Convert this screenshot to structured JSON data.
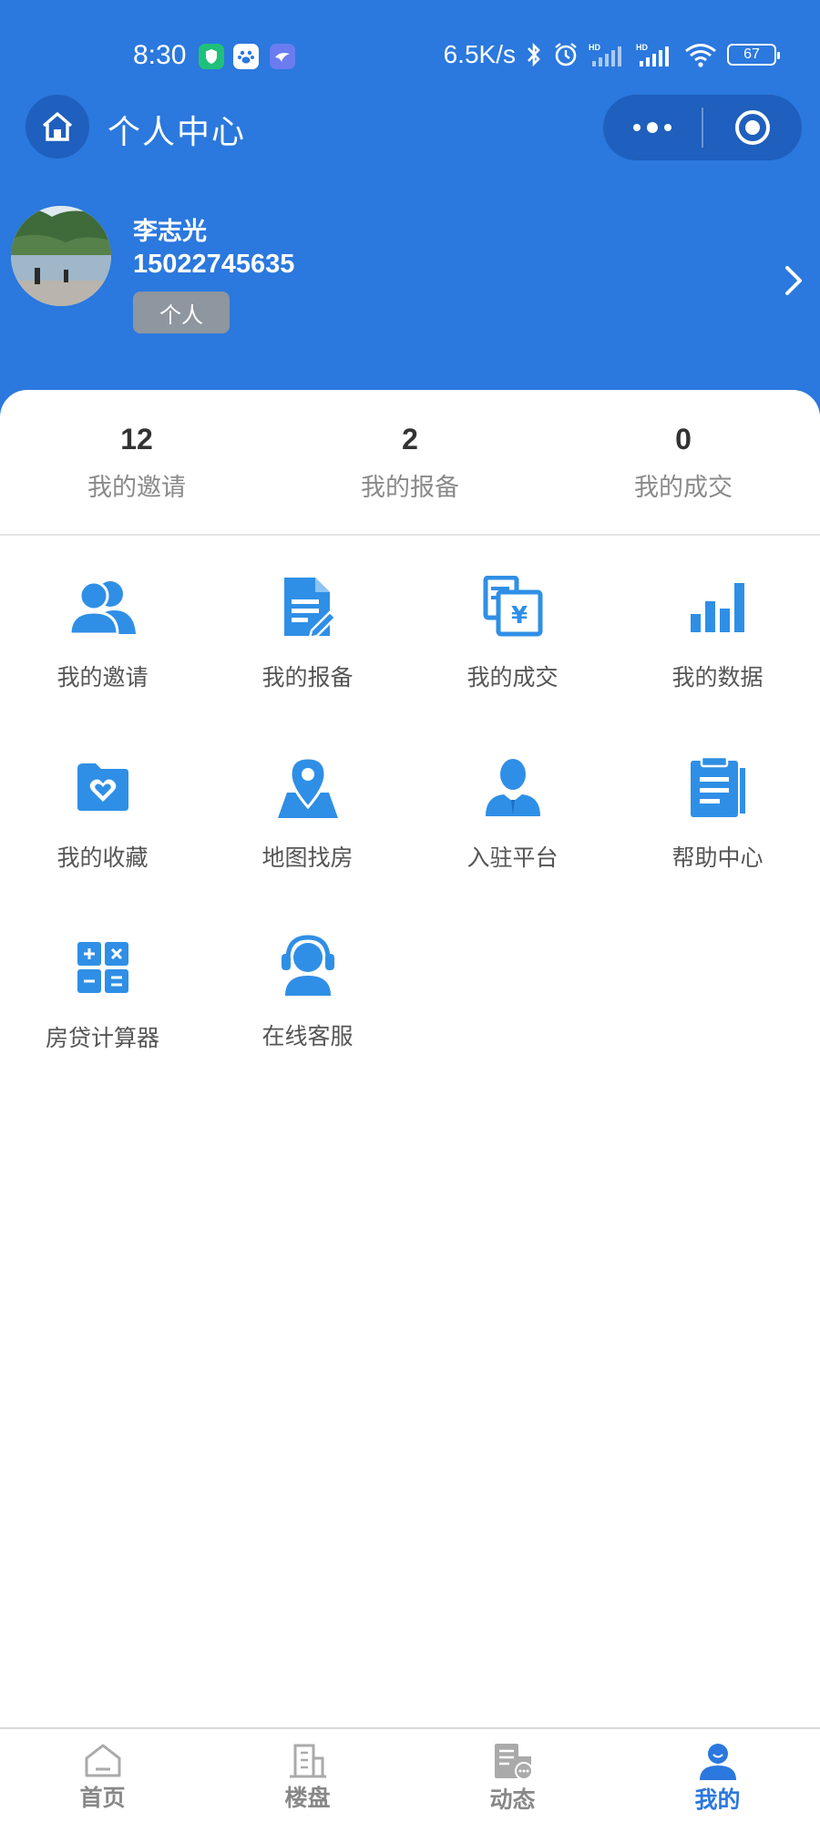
{
  "status_bar": {
    "time": "8:30",
    "network_speed": "6.5K/s",
    "battery": "67",
    "icons": [
      "shield-app-icon",
      "baidu-icon",
      "bird-app-icon",
      "bluetooth-icon",
      "alarm-icon",
      "signal-hd-icon",
      "signal-hd-icon",
      "wifi-icon",
      "battery-icon"
    ]
  },
  "nav": {
    "title": "个人中心",
    "home_icon": "home-icon",
    "more_icon": "more-dots-icon",
    "close_icon": "target-circle-icon"
  },
  "profile": {
    "name": "李志光",
    "phone": "15022745635",
    "tag": "个人"
  },
  "stats": [
    {
      "value": "12",
      "label": "我的邀请"
    },
    {
      "value": "2",
      "label": "我的报备"
    },
    {
      "value": "0",
      "label": "我的成交"
    }
  ],
  "menu": [
    {
      "label": "我的邀请",
      "icon": "users-icon"
    },
    {
      "label": "我的报备",
      "icon": "document-edit-icon"
    },
    {
      "label": "我的成交",
      "icon": "deal-receipt-icon"
    },
    {
      "label": "我的数据",
      "icon": "bar-chart-icon"
    },
    {
      "label": "我的收藏",
      "icon": "folder-heart-icon"
    },
    {
      "label": "地图找房",
      "icon": "map-pin-icon"
    },
    {
      "label": "入驻平台",
      "icon": "agent-person-icon"
    },
    {
      "label": "帮助中心",
      "icon": "clipboard-icon"
    },
    {
      "label": "房贷计算器",
      "icon": "calculator-icon"
    },
    {
      "label": "在线客服",
      "icon": "headset-icon"
    }
  ],
  "tabbar": [
    {
      "label": "首页",
      "icon": "home-tab-icon",
      "active": false
    },
    {
      "label": "楼盘",
      "icon": "building-tab-icon",
      "active": false
    },
    {
      "label": "动态",
      "icon": "news-tab-icon",
      "active": false
    },
    {
      "label": "我的",
      "icon": "user-tab-icon",
      "active": true
    }
  ],
  "colors": {
    "primary": "#2b78de",
    "icon_blue": "#2f8fe6",
    "tag_gray": "#8e969f"
  }
}
